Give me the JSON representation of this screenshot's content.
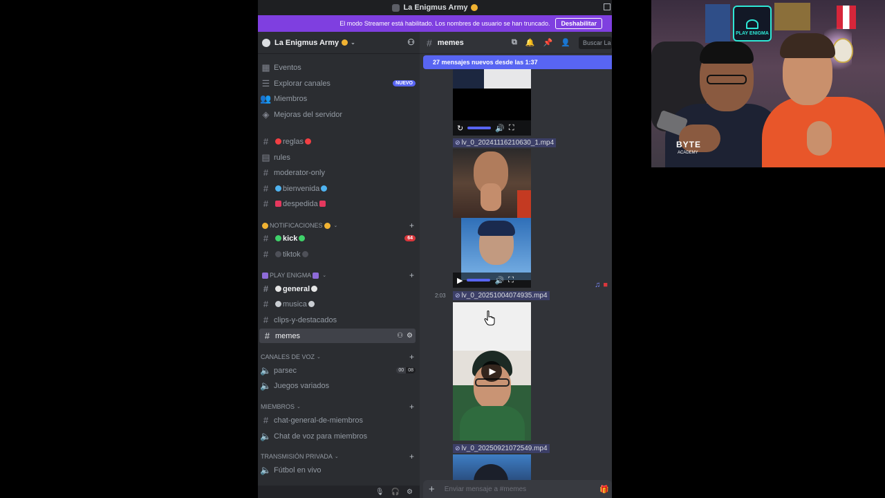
{
  "window": {
    "title": "La Enigmus Army"
  },
  "streamer_mode": {
    "message": "El modo Streamer está habilitado. Los nombres de usuario se han truncado.",
    "button_label": "Deshabilitar"
  },
  "server": {
    "name": "La Enigmus Army"
  },
  "sidebar": {
    "top_items": [
      {
        "label": "Eventos",
        "icon": "calendar-icon"
      },
      {
        "label": "Explorar canales",
        "icon": "browse-icon",
        "badge": "NUEVO"
      },
      {
        "label": "Miembros",
        "icon": "members-icon"
      },
      {
        "label": "Mejoras del servidor",
        "icon": "boost-icon"
      }
    ],
    "channels_ungrouped": [
      {
        "label": "reglas"
      },
      {
        "label": "rules"
      },
      {
        "label": "moderator-only"
      },
      {
        "label": "bienvenida"
      },
      {
        "label": "despedida"
      }
    ],
    "categories": {
      "notificaciones": {
        "label": "NOTIFICACIONES"
      },
      "play_enigma": {
        "label": "PLAY ENIGMA"
      },
      "canales_voz": {
        "label": "CANALES DE VOZ"
      },
      "miembros": {
        "label": "MIEMBROS"
      },
      "transmision": {
        "label": "TRANSMISIÓN PRIVADA"
      }
    },
    "notificaciones_channels": [
      {
        "label": "kick",
        "badge": "64"
      },
      {
        "label": "tiktok"
      }
    ],
    "play_enigma_channels": [
      {
        "label": "general"
      },
      {
        "label": "musica"
      },
      {
        "label": "clips-y-destacados"
      },
      {
        "label": "memes"
      }
    ],
    "voice_channels": [
      {
        "label": "parsec",
        "count_left": "00",
        "count_right": "08"
      },
      {
        "label": "Juegos variados"
      }
    ],
    "member_channels": [
      {
        "label": "chat-general-de-miembros"
      },
      {
        "label": "Chat de voz para miembros"
      }
    ],
    "private_channels": [
      {
        "label": "Fútbol en vivo"
      }
    ]
  },
  "chat": {
    "channel_name": "memes",
    "search_placeholder": "Buscar La",
    "new_messages_banner": "27 mensajes nuevos desde las 1:37",
    "attachments": [
      {
        "filename": "lv_0_20241116210630_1.mp4"
      },
      {
        "filename": "lv_0_20251004074935.mp4",
        "timestamp": "2:03"
      },
      {
        "filename": "lv_0_20250921072549.mp4"
      }
    ],
    "composer_placeholder": "Enviar mensaje a #memes"
  },
  "webcam": {
    "neon_text": "PLAY ENIGMA",
    "shirt_text": "BYTE",
    "shirt_subtext": "ACADEMY"
  },
  "colors": {
    "streamer_bar": "#7f3fe0",
    "accent": "#5865f2",
    "sidebar_bg": "#2b2d31",
    "chat_bg": "#313338",
    "badge_red": "#da373c"
  }
}
